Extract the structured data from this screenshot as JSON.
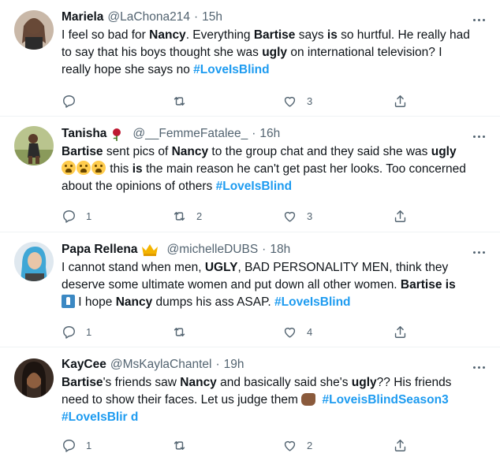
{
  "tweets": [
    {
      "name": "Mariela",
      "handle": "@LaChona214",
      "time": "15h",
      "segments": [
        {
          "t": "I feel so bad for ",
          "s": "text"
        },
        {
          "t": "Nancy",
          "s": "bold"
        },
        {
          "t": ". Everything ",
          "s": "text"
        },
        {
          "t": "Bartise",
          "s": "bold"
        },
        {
          "t": " says ",
          "s": "text"
        },
        {
          "t": "is",
          "s": "bold"
        },
        {
          "t": " so hurtful. He really had to say that his boys thought she was ",
          "s": "text"
        },
        {
          "t": "ugly",
          "s": "bold"
        },
        {
          "t": " on international television? I really hope she says no ",
          "s": "text"
        },
        {
          "t": "#LoveIsBlind",
          "s": "hashtag"
        }
      ],
      "replies": "",
      "retweets": "",
      "likes": "3"
    },
    {
      "name": "Tanisha",
      "handle": "@__FemmeFatalee_",
      "time": "16h",
      "badge": "rose",
      "segments": [
        {
          "t": "Bartise",
          "s": "bold"
        },
        {
          "t": " sent pics of ",
          "s": "text"
        },
        {
          "t": "Nancy",
          "s": "bold"
        },
        {
          "t": " to the group chat and they said she was ",
          "s": "text"
        },
        {
          "t": "ugly",
          "s": "bold"
        },
        {
          "t": " ",
          "s": "text"
        },
        {
          "t": "face-crying",
          "s": "emoji"
        },
        {
          "t": "face-crying",
          "s": "emoji"
        },
        {
          "t": "face-crying",
          "s": "emoji"
        },
        {
          "t": " this ",
          "s": "text"
        },
        {
          "t": "is",
          "s": "bold"
        },
        {
          "t": " the main reason he can't get past her looks. Too concerned about the  opinions of others ",
          "s": "text"
        },
        {
          "t": "#LoveIsBlind",
          "s": "hashtag"
        }
      ],
      "replies": "1",
      "retweets": "2",
      "likes": "3"
    },
    {
      "name": "Papa Rellena",
      "handle": "@michelleDUBS",
      "time": "18h",
      "badge": "crown",
      "segments": [
        {
          "t": "I cannot stand when men, ",
          "s": "text"
        },
        {
          "t": "UGLY",
          "s": "bold"
        },
        {
          "t": ", BAD PERSONALITY MEN, think they deserve some ultimate women and put down all other women. ",
          "s": "text"
        },
        {
          "t": "Bartise is",
          "s": "bold"
        },
        {
          "t": " ",
          "s": "text"
        },
        {
          "t": "toilet",
          "s": "emoji"
        },
        {
          "t": " I hope ",
          "s": "text"
        },
        {
          "t": "Nancy",
          "s": "bold"
        },
        {
          "t": " dumps his ass ASAP. ",
          "s": "text"
        },
        {
          "t": "#LoveIsBlind",
          "s": "hashtag"
        }
      ],
      "replies": "1",
      "retweets": "",
      "likes": "4"
    },
    {
      "name": "KayCee",
      "handle": "@MsKaylaChantel",
      "time": "19h",
      "segments": [
        {
          "t": "Bartise",
          "s": "bold"
        },
        {
          "t": "'s friends saw ",
          "s": "text"
        },
        {
          "t": "Nancy",
          "s": "bold"
        },
        {
          "t": " and basically said she's ",
          "s": "text"
        },
        {
          "t": "ugly",
          "s": "bold"
        },
        {
          "t": "?? His friends need to show their faces. Let us judge them ",
          "s": "text"
        },
        {
          "t": "point-hand",
          "s": "emoji"
        },
        {
          "t": " ",
          "s": "text"
        },
        {
          "t": "#LoveisBlindSeason3",
          "s": "hashtag"
        },
        {
          "t": " ",
          "s": "text"
        },
        {
          "t": "#LoveIsBlir d",
          "s": "hashtag"
        }
      ],
      "replies": "1",
      "retweets": "",
      "likes": "2"
    }
  ],
  "colors": {
    "text": "#0f1419",
    "muted": "#536471",
    "link": "#1d9bf0",
    "divider": "#eff3f4"
  }
}
